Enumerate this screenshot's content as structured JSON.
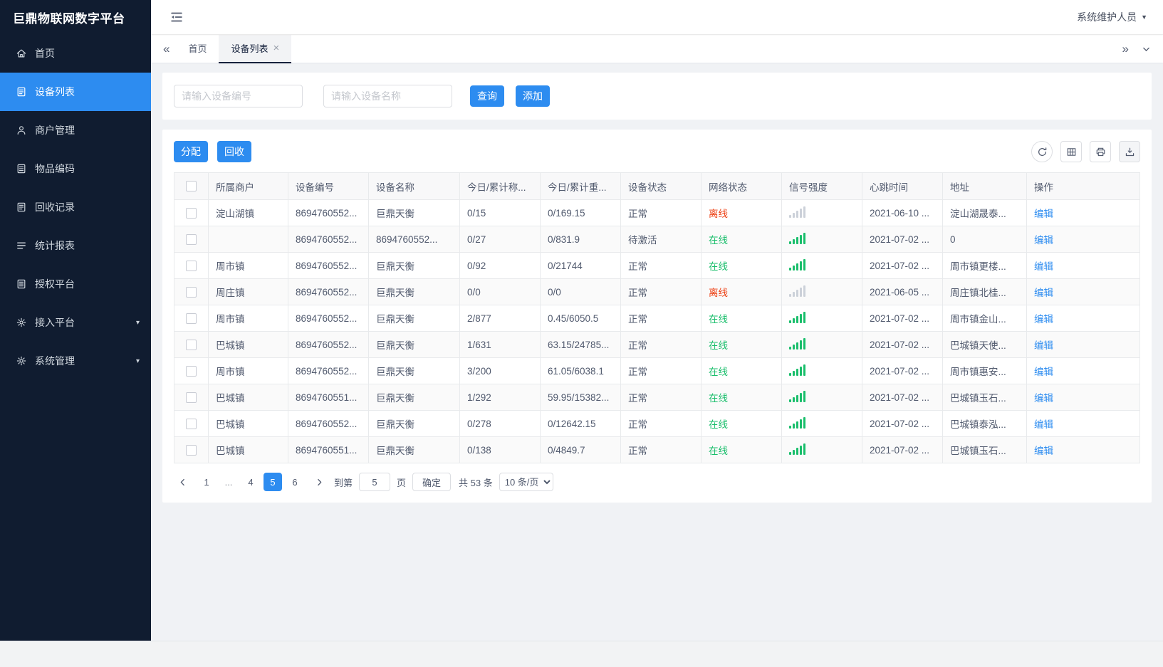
{
  "app": {
    "logo": "巨鼎物联网数字平台",
    "user": "系统维护人员"
  },
  "colors": {
    "primary": "#2d8cf0",
    "online": "#19be6b",
    "offline": "#ed4014",
    "signal_strong": "#19be6b",
    "signal_weak": "#ccd1d9"
  },
  "sidebar": {
    "items": [
      {
        "key": "home",
        "label": "首页",
        "icon": "home-icon",
        "active": false,
        "expandable": false
      },
      {
        "key": "device-list",
        "label": "设备列表",
        "icon": "device-list-icon",
        "active": true,
        "expandable": false
      },
      {
        "key": "merchant-management",
        "label": "商户管理",
        "icon": "merchant-icon",
        "active": false,
        "expandable": false
      },
      {
        "key": "item-coding",
        "label": "物品编码",
        "icon": "item-code-icon",
        "active": false,
        "expandable": false
      },
      {
        "key": "recycle-records",
        "label": "回收记录",
        "icon": "recycle-record-icon",
        "active": false,
        "expandable": false
      },
      {
        "key": "statistics-report",
        "label": "统计报表",
        "icon": "report-icon",
        "active": false,
        "expandable": false
      },
      {
        "key": "authorization-platform",
        "label": "授权平台",
        "icon": "authorize-icon",
        "active": false,
        "expandable": false
      },
      {
        "key": "access-platform",
        "label": "接入平台",
        "icon": "access-gear-icon",
        "active": false,
        "expandable": true
      },
      {
        "key": "system-management",
        "label": "系统管理",
        "icon": "system-gear-icon",
        "active": false,
        "expandable": true
      }
    ]
  },
  "tabs": [
    {
      "key": "home",
      "label": "首页",
      "active": false,
      "closable": false
    },
    {
      "key": "device-list",
      "label": "设备列表",
      "active": true,
      "closable": true
    }
  ],
  "filters": {
    "device_no_placeholder": "请输入设备编号",
    "device_name_placeholder": "请输入设备名称",
    "query": "查询",
    "add": "添加"
  },
  "actions": {
    "allocate": "分配",
    "recycle": "回收"
  },
  "table": {
    "headers": [
      "所属商户",
      "设备编号",
      "设备名称",
      "今日/累计称...",
      "今日/累计重...",
      "设备状态",
      "网络状态",
      "信号强度",
      "心跳时间",
      "地址",
      "操作"
    ],
    "header_keys": [
      "merchant",
      "device-number",
      "device-name",
      "today-total-count",
      "today-total-weight",
      "device-status",
      "network-status",
      "signal-strength",
      "heartbeat-time",
      "address",
      "actions"
    ],
    "rows": [
      {
        "merchant": "淀山湖镇",
        "device_no": "8694760552...",
        "device_name": "巨鼎天衡",
        "count": "0/15",
        "weight": "0/169.15",
        "status": "正常",
        "network": "离线",
        "network_state": "offline",
        "signal": "weak",
        "heartbeat": "2021-06-10 ...",
        "address": "淀山湖晟泰...",
        "action": "编辑"
      },
      {
        "merchant": "",
        "device_no": "8694760552...",
        "device_name": "8694760552...",
        "count": "0/27",
        "weight": "0/831.9",
        "status": "待激活",
        "network": "在线",
        "network_state": "online",
        "signal": "strong",
        "heartbeat": "2021-07-02 ...",
        "address": "0",
        "action": "编辑"
      },
      {
        "merchant": "周市镇",
        "device_no": "8694760552...",
        "device_name": "巨鼎天衡",
        "count": "0/92",
        "weight": "0/21744",
        "status": "正常",
        "network": "在线",
        "network_state": "online",
        "signal": "strong",
        "heartbeat": "2021-07-02 ...",
        "address": "周市镇更楼...",
        "action": "编辑"
      },
      {
        "merchant": "周庄镇",
        "device_no": "8694760552...",
        "device_name": "巨鼎天衡",
        "count": "0/0",
        "weight": "0/0",
        "status": "正常",
        "network": "离线",
        "network_state": "offline",
        "signal": "weak",
        "heartbeat": "2021-06-05 ...",
        "address": "周庄镇北桂...",
        "action": "编辑"
      },
      {
        "merchant": "周市镇",
        "device_no": "8694760552...",
        "device_name": "巨鼎天衡",
        "count": "2/877",
        "weight": "0.45/6050.5",
        "status": "正常",
        "network": "在线",
        "network_state": "online",
        "signal": "strong",
        "heartbeat": "2021-07-02 ...",
        "address": "周市镇金山...",
        "action": "编辑"
      },
      {
        "merchant": "巴城镇",
        "device_no": "8694760552...",
        "device_name": "巨鼎天衡",
        "count": "1/631",
        "weight": "63.15/24785...",
        "status": "正常",
        "network": "在线",
        "network_state": "online",
        "signal": "strong",
        "heartbeat": "2021-07-02 ...",
        "address": "巴城镇天使...",
        "action": "编辑"
      },
      {
        "merchant": "周市镇",
        "device_no": "8694760552...",
        "device_name": "巨鼎天衡",
        "count": "3/200",
        "weight": "61.05/6038.1",
        "status": "正常",
        "network": "在线",
        "network_state": "online",
        "signal": "strong",
        "heartbeat": "2021-07-02 ...",
        "address": "周市镇惠安...",
        "action": "编辑"
      },
      {
        "merchant": "巴城镇",
        "device_no": "8694760551...",
        "device_name": "巨鼎天衡",
        "count": "1/292",
        "weight": "59.95/15382...",
        "status": "正常",
        "network": "在线",
        "network_state": "online",
        "signal": "strong",
        "heartbeat": "2021-07-02 ...",
        "address": "巴城镇玉石...",
        "action": "编辑"
      },
      {
        "merchant": "巴城镇",
        "device_no": "8694760552...",
        "device_name": "巨鼎天衡",
        "count": "0/278",
        "weight": "0/12642.15",
        "status": "正常",
        "network": "在线",
        "network_state": "online",
        "signal": "strong",
        "heartbeat": "2021-07-02 ...",
        "address": "巴城镇泰泓...",
        "action": "编辑"
      },
      {
        "merchant": "巴城镇",
        "device_no": "8694760551...",
        "device_name": "巨鼎天衡",
        "count": "0/138",
        "weight": "0/4849.7",
        "status": "正常",
        "network": "在线",
        "network_state": "online",
        "signal": "strong",
        "heartbeat": "2021-07-02 ...",
        "address": "巴城镇玉石...",
        "action": "编辑"
      }
    ]
  },
  "pagination": {
    "pages": [
      "1",
      "...",
      "4",
      "5",
      "6"
    ],
    "active_page": "5",
    "goto_label": "到第",
    "goto_value": "5",
    "page_unit": "页",
    "confirm": "确定",
    "total": "共 53 条",
    "page_size": "10 条/页"
  }
}
